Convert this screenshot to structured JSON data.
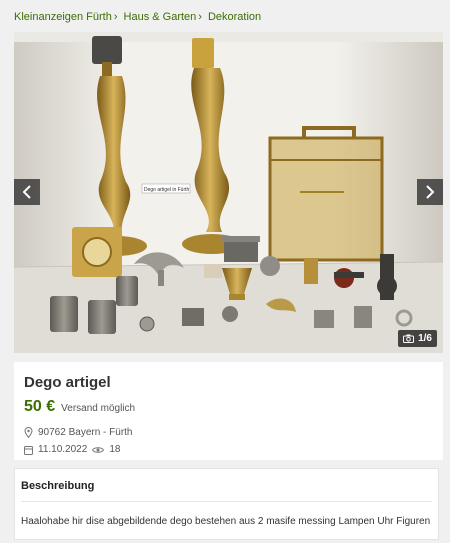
{
  "breadcrumb": [
    {
      "label": "Kleinanzeigen Fürth"
    },
    {
      "label": "Haus & Garten"
    },
    {
      "label": "Dekoration"
    }
  ],
  "gallery": {
    "counter": "1/6",
    "photo_label": "Dego artigel in Fürth"
  },
  "listing": {
    "title": "Dego artigel",
    "price": "50 €",
    "shipping": "Versand möglich",
    "location": "90762 Bayern - Fürth",
    "date": "11.10.2022",
    "views": "18"
  },
  "description": {
    "heading": "Beschreibung",
    "text": "Haalohabe hir dise abgebildende dego bestehen aus 2 masife messing Lampen Uhr Figuren"
  },
  "colors": {
    "accent": "#3b6e00",
    "brass": "#b8953a"
  },
  "icons": {
    "prev": "chevron-left-icon",
    "next": "chevron-right-icon",
    "camera": "camera-icon",
    "location": "location-pin-icon",
    "calendar": "calendar-icon",
    "views": "eye-icon"
  }
}
